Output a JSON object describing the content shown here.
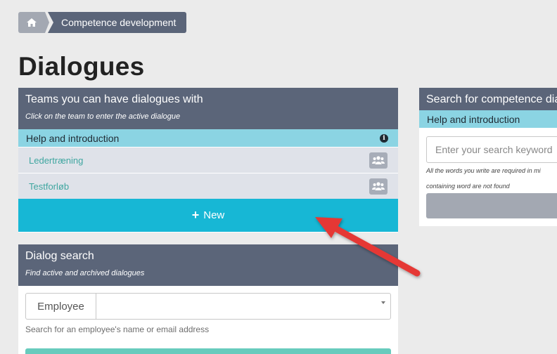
{
  "breadcrumb": {
    "home_icon": "home-icon",
    "current": "Competence development"
  },
  "page_title": "Dialogues",
  "teams_panel": {
    "title": "Teams you can have dialogues with",
    "subtitle": "Click on the team to enter the active dialogue",
    "help_label": "Help and introduction",
    "help_icon": "info-icon",
    "teams": [
      {
        "name": "Ledertræning",
        "icon": "group-icon"
      },
      {
        "name": "Testforløb",
        "icon": "group-icon"
      }
    ],
    "new_button": "New"
  },
  "dialog_search": {
    "title": "Dialog search",
    "subtitle": "Find active and archived dialogues",
    "employee_label": "Employee",
    "employee_value": "",
    "hint": "Search for an employee's name or email address"
  },
  "competence_search": {
    "title": "Search for competence dia",
    "help_label": "Help and introduction",
    "placeholder": "Enter your search keyword",
    "note_line1": "All the words you write are required in mi",
    "note_line2": "containing word are not found"
  },
  "colors": {
    "header": "#5b6579",
    "help_bar": "#8bd4e3",
    "new_button": "#17b7d5",
    "team_link": "#3fa6a0",
    "annotation_arrow": "#e53935"
  }
}
